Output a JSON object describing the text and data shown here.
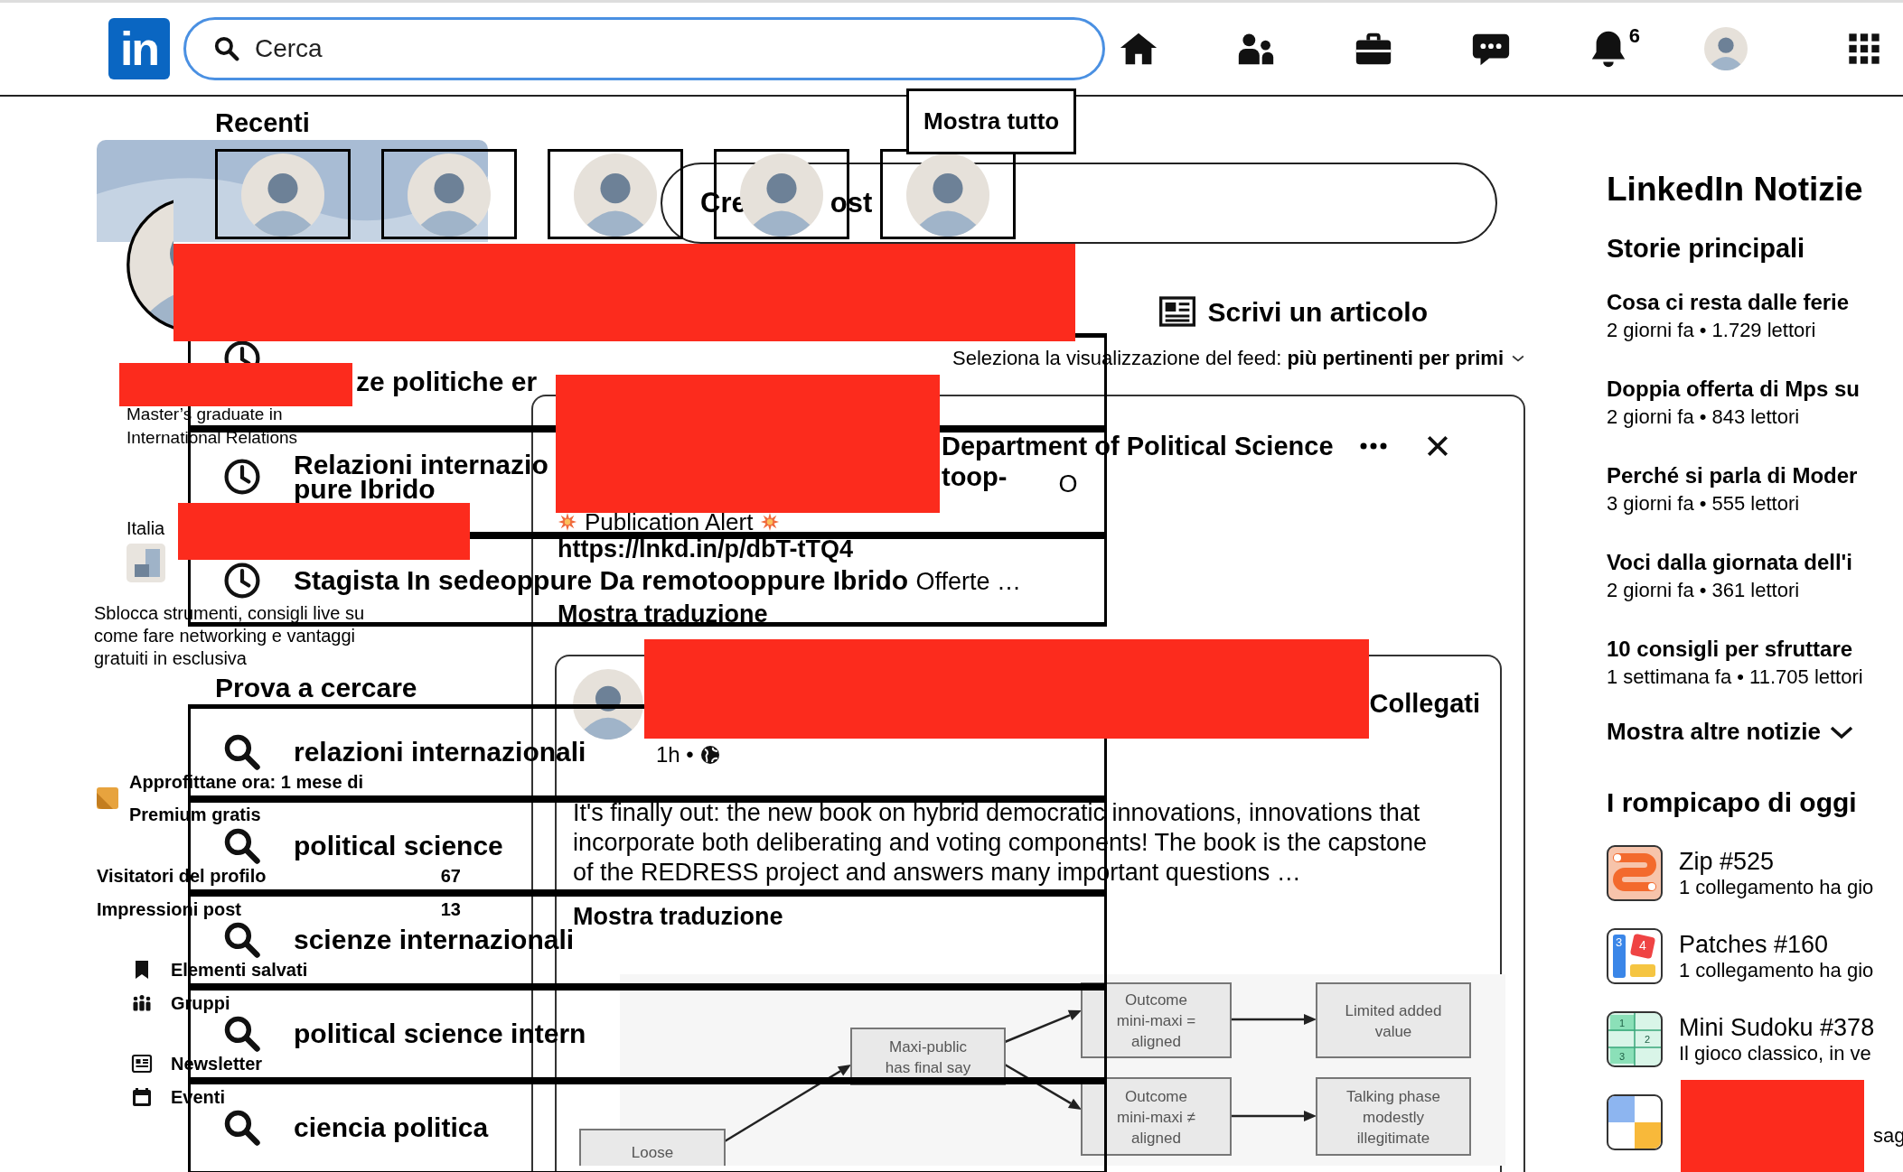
{
  "nav": {
    "logo": "in",
    "search": {
      "placeholder": "Cerca"
    },
    "notifications_badge": "6"
  },
  "search_dropdown": {
    "recent_heading": "Recenti",
    "show_all": "Mostra tutto",
    "recent_people": [
      {
        "kind": "avatar"
      },
      {
        "kind": "avatar"
      },
      {
        "kind": "avatar"
      },
      {
        "kind": "avatar"
      },
      {
        "kind": "avatar"
      }
    ],
    "history": [
      {
        "lines": [
          "ze politiche er"
        ]
      },
      {
        "lines": [
          "Relazioni internazio",
          "pure Ibrido"
        ]
      },
      {
        "lines": [
          "Stagista In sedeoppure Da remotooppure Ibrido"
        ],
        "suffix": "Offerte …"
      }
    ],
    "suggestions_heading": "Prova a cercare",
    "suggestions": [
      "relazioni internazionali",
      "political science",
      "scienze internazionali",
      "political science intern",
      "ciencia politica"
    ]
  },
  "profile": {
    "headline": "Master’s graduate in International Relations",
    "location": "Italia",
    "premium_pitch": "Sblocca strumenti, consigli live su come fare networking e vantaggi gratuiti in esclusiva",
    "premium_offer": "Approfittane ora: 1 mese di Premium gratis",
    "stats": [
      {
        "label": "Visitatori del profilo",
        "value": "67"
      },
      {
        "label": "Impressioni post",
        "value": "13"
      }
    ],
    "shortcuts": [
      {
        "kind": "bookmark",
        "label": "Elementi salvati"
      },
      {
        "kind": "groups",
        "label": "Gruppi"
      },
      {
        "kind": "newsletter",
        "label": "Newsletter"
      },
      {
        "kind": "calendar",
        "label": "Eventi"
      }
    ]
  },
  "feed": {
    "share_prompt_parts": [
      "Cre",
      "ost"
    ],
    "write_article": "Scrivi un articolo",
    "sort_label": "Seleziona la visualizzazione del feed:",
    "sort_value": "più pertinenti per primi",
    "post": {
      "author": "Department of Political Science",
      "author_line2": "toop-",
      "author_line3": "O",
      "alert": "Publication Alert",
      "link": "https://lnkd.in/p/dbT-tTQ4",
      "translate": "Mostra traduzione",
      "shared": {
        "action": "Collegati",
        "time": "1h •",
        "text": "It's finally out: the new book on hybrid democratic innovations, innovations that incorporate both deliberating and voting components! The book is the capstone of the REDRESS project and answers many important questions …",
        "translate": "Mostra traduzione",
        "diagram": {
          "nodes": [
            {
              "lines": [
                "Loose"
              ]
            },
            {
              "lines": [
                "Maxi-public",
                "has final say"
              ]
            },
            {
              "lines": [
                "Outcome",
                "mini-maxi =",
                "aligned"
              ]
            },
            {
              "lines": [
                "Outcome",
                "mini-maxi ≠",
                "aligned"
              ]
            },
            {
              "lines": [
                "Limited added",
                "value"
              ]
            },
            {
              "lines": [
                "Talking phase",
                "modestly",
                "illegitimate"
              ]
            }
          ]
        }
      }
    }
  },
  "news": {
    "title": "LinkedIn Notizie",
    "subtitle": "Storie principali",
    "items": [
      {
        "title": "Cosa ci resta dalle ferie",
        "meta": "2 giorni fa • 1.729 lettori"
      },
      {
        "title": "Doppia offerta di Mps su",
        "meta": "2 giorni fa • 843 lettori"
      },
      {
        "title": "Perché si parla di Moder",
        "meta": "3 giorni fa • 555 lettori"
      },
      {
        "title": "Voci dalla giornata dell'i",
        "meta": "2 giorni fa • 361 lettori"
      },
      {
        "title": "10 consigli per sfruttare",
        "meta": "1 settimana fa • 11.705 lettori"
      }
    ],
    "more": "Mostra altre notizie",
    "puzzles_heading": "I rompicapo di oggi",
    "games": [
      {
        "kind": "zip",
        "title": "Zip #525",
        "subtitle": "1 collegamento ha gio"
      },
      {
        "kind": "patches",
        "title": "Patches #160",
        "subtitle": "1 collegamento ha gio",
        "icon_labels": [
          "3",
          "4"
        ]
      },
      {
        "kind": "sudoku",
        "title": "Mini Sudoku #378",
        "subtitle": "Il gioco classico, in ve",
        "icon_labels": [
          "1",
          "2",
          "3"
        ]
      },
      {
        "kind": "quadrants",
        "subtitle": "sag"
      }
    ]
  }
}
